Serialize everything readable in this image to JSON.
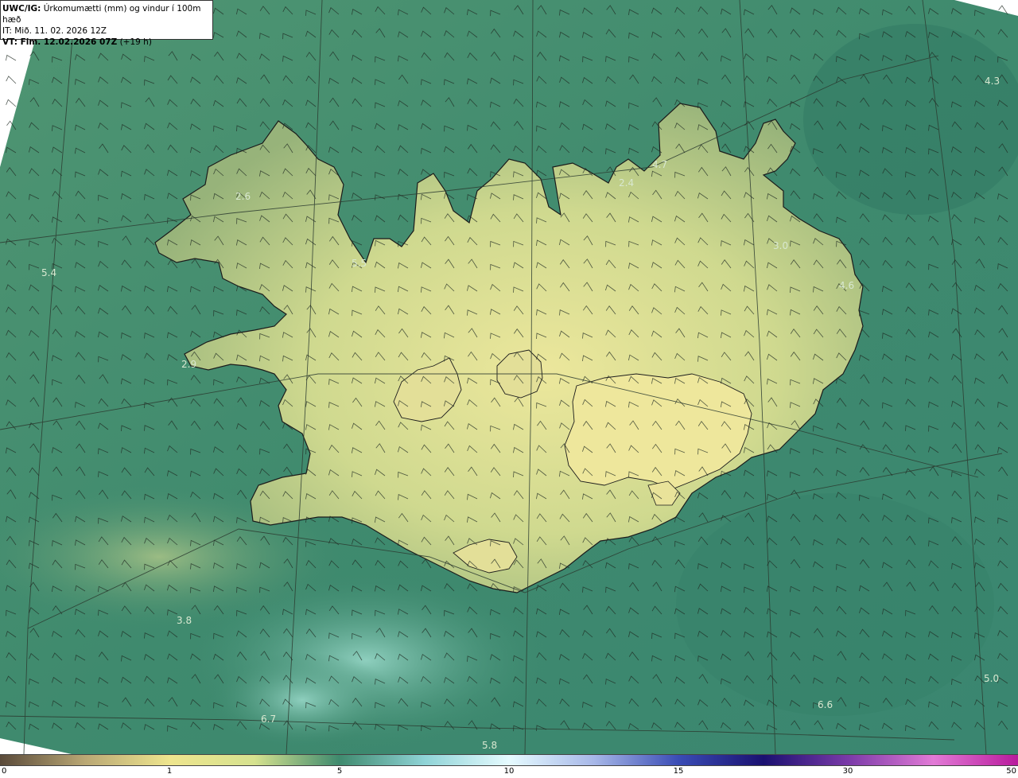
{
  "header": {
    "model_label": "UWC/IG:",
    "title": "Úrkomumætti (mm) og vindur í 100m hæð",
    "it_line": "IT: Mið. 11. 02. 2026 12Z",
    "vt_prefix": "VT: Fim. 12.02.2026 07Z",
    "vt_suffix": "(+19 h)"
  },
  "map_labels": [
    {
      "text": "4.3"
    },
    {
      "text": "4.7"
    },
    {
      "text": "2.4"
    },
    {
      "text": "2.6"
    },
    {
      "text": "5.5"
    },
    {
      "text": "5.4"
    },
    {
      "text": "3.0"
    },
    {
      "text": "4.6"
    },
    {
      "text": "2.9"
    },
    {
      "text": "3.8"
    },
    {
      "text": "6.6"
    },
    {
      "text": "5.0"
    },
    {
      "text": "5.8"
    },
    {
      "text": "6.7"
    }
  ],
  "colorbar": {
    "ticks": [
      "0",
      "1",
      "5",
      "10",
      "15",
      "30",
      "50"
    ],
    "colors": [
      "#5a4a3a",
      "#b9a774",
      "#eee58e",
      "#d6e28f",
      "#3f8a6e",
      "#8fd3d6",
      "#e6fbff",
      "#a8b8e8",
      "#3a4cb5",
      "#1a1070",
      "#7a3aa8",
      "#e27ad6",
      "#b81a9c"
    ]
  },
  "colors": {
    "ocean": "#3f8a6e",
    "ocean_dark": "#2f7862",
    "land": "#c8d690",
    "land_high": "#e6e39a",
    "coast": "#1b1b1b"
  }
}
